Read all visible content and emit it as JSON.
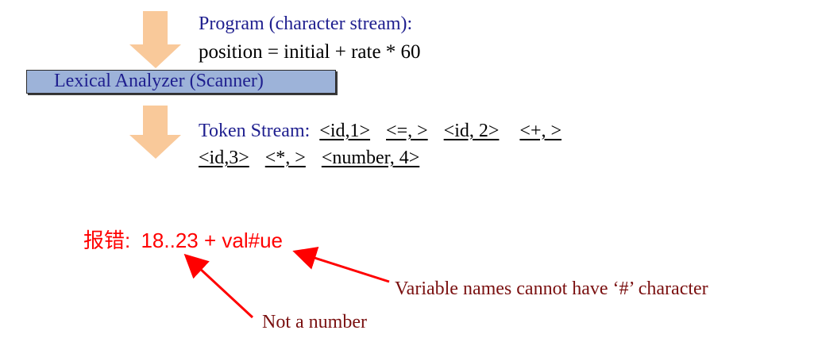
{
  "diagram": {
    "program_label": "Program (character stream):",
    "program_code": "position = initial + rate * 60",
    "scanner_label": "Lexical Analyzer (Scanner)",
    "token_stream_label": "Token Stream:",
    "tokens_line1": [
      "<id,1>",
      "<=, >",
      "<id, 2>",
      "<+, >"
    ],
    "tokens_line2": [
      "<id,3>",
      "<*, >",
      "<number, 4>"
    ],
    "error_label": "报错:",
    "error_expression": "18..23 + val#ue",
    "annotation_variable": "Variable names cannot have ‘#’ character",
    "annotation_number": "Not a number"
  },
  "colors": {
    "arrow_fill": "#f9c99a",
    "box_fill": "#9db3d9",
    "label_blue": "#1f1f8f",
    "error_red": "#ff0000",
    "annotation_dark_red": "#7a1010"
  }
}
